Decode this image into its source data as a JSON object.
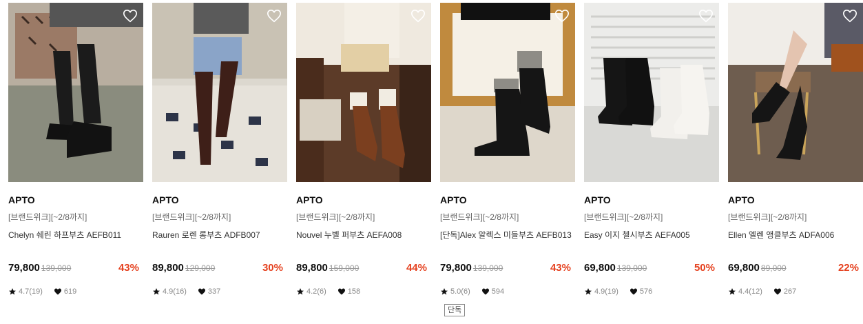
{
  "products": [
    {
      "brand": "APTO",
      "promo": "[브랜드위크][~2/8까지]",
      "name": "Chelyn 쉐린 하프부츠 AEFB011",
      "price": "79,800",
      "original": "139,000",
      "discount": "43%",
      "rating": "4.7(19)",
      "likes": "619",
      "tag": ""
    },
    {
      "brand": "APTO",
      "promo": "[브랜드위크][~2/8까지]",
      "name": "Rauren 로렌 롱부츠 ADFB007",
      "price": "89,800",
      "original": "129,000",
      "discount": "30%",
      "rating": "4.9(16)",
      "likes": "337",
      "tag": ""
    },
    {
      "brand": "APTO",
      "promo": "[브랜드위크][~2/8까지]",
      "name": "Nouvel 누벨 퍼부츠 AEFA008",
      "price": "89,800",
      "original": "159,000",
      "discount": "44%",
      "rating": "4.2(6)",
      "likes": "158",
      "tag": ""
    },
    {
      "brand": "APTO",
      "promo": "[브랜드위크][~2/8까지]",
      "name": "[단독]Alex 알렉스 미들부츠 AEFB013",
      "price": "79,800",
      "original": "139,000",
      "discount": "43%",
      "rating": "5.0(6)",
      "likes": "594",
      "tag": "단독"
    },
    {
      "brand": "APTO",
      "promo": "[브랜드위크][~2/8까지]",
      "name": "Easy 이지 첼시부츠 AEFA005",
      "price": "69,800",
      "original": "139,000",
      "discount": "50%",
      "rating": "4.9(19)",
      "likes": "576",
      "tag": ""
    },
    {
      "brand": "APTO",
      "promo": "[브랜드위크][~2/8까지]",
      "name": "Ellen 엘렌 앵클부츠 ADFA006",
      "price": "69,800",
      "original": "89,000",
      "discount": "22%",
      "rating": "4.4(12)",
      "likes": "267",
      "tag": ""
    }
  ],
  "icons": {
    "favorite": "heart-outline-icon",
    "star": "star-icon",
    "like": "heart-filled-icon"
  },
  "colors": {
    "discount": "#e5411f",
    "price": "#111111",
    "strike": "#999999"
  }
}
